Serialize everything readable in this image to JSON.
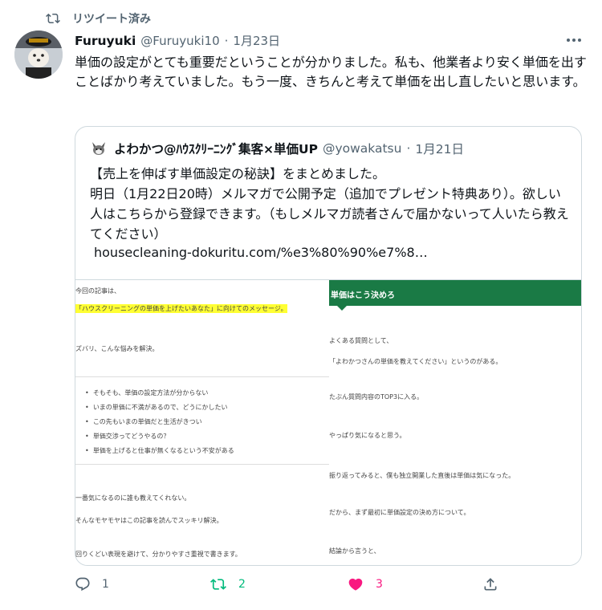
{
  "retweet_banner": "リツイート済み",
  "tweet": {
    "name": "Furuyuki",
    "handle": "@Furuyuki10",
    "sep": "·",
    "date": "1月23日",
    "text": "単価の設定がとても重要だということが分かりました。私も、他業者より安く単価を出すことばかり考えていました。もう一度、きちんと考えて単価を出し直したいと思います。"
  },
  "quote": {
    "name": "よわかつ@ﾊｳｽｸﾘｰﾆﾝｸﾞ集客×単価UP",
    "handle": "@yowakatsu",
    "sep": "·",
    "date": "1月21日",
    "line1": "【売上を伸ばす単価設定の秘訣】をまとめました。",
    "line2": "明日（1月22日20時）メルマガで公開予定（追加でプレゼント特典あり）。欲しい人はこちらから登録できます。（もしメルマガ読者さんで届かないって人いたら教えてください）",
    "link": "housecleaning-dokuritu.com/%e3%80%90%e7%8…"
  },
  "media": {
    "left": {
      "l1": "今回の記事は、",
      "l2": "「ハウスクリーニングの単価を上げたいあなた」に向けてのメッセージ。",
      "l3": "ズバリ、こんな悩みを解決。",
      "bullets": [
        "そもそも、単価の設定方法が分からない",
        "いまの単価に不満があるので、どうにかしたい",
        "この先もいまの単価だと生活がきつい",
        "単価交渉ってどうやるの？",
        "単価を上げると仕事が無くなるという不安がある"
      ],
      "l4": "一番気になるのに誰も教えてくれない。",
      "l5": "そんなモヤモヤはこの記事を読んでスッキリ解決。",
      "l6": "回りくどい表現を避けて、分かりやすさ重視で書きます。"
    },
    "right": {
      "heading": "単価はこう決めろ",
      "r1": "よくある質問として、",
      "r2": "「よわかつさんの単価を教えてください」というのがある。",
      "r3": "たぶん質問内容のTOP3に入る。",
      "r4": "やっぱり気になると思う。",
      "r5": "振り返ってみると、僕も独立開業した直後は単価は気になった。",
      "r6": "だから、まず最初に単価設定の決め方について。",
      "r7": "結論から言うと、"
    }
  },
  "actions": {
    "reply_count": "1",
    "retweet_count": "2",
    "like_count": "3"
  },
  "colors": {
    "retweet": "#00ba7c",
    "like": "#f91880",
    "muted": "#536471",
    "green_bar": "#1a7a45"
  }
}
